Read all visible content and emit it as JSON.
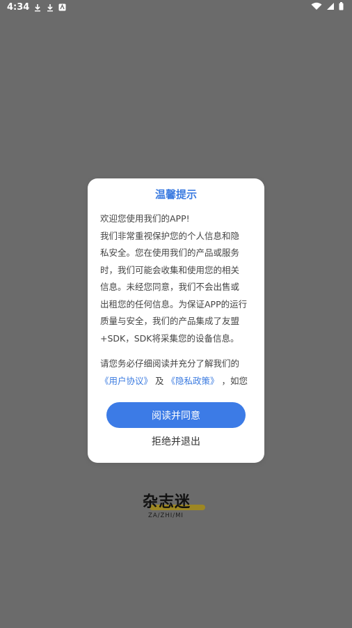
{
  "status_bar": {
    "time": "4:34",
    "left_icons": [
      "download-icon",
      "download-icon",
      "accessibility-icon"
    ],
    "right_icons": [
      "wifi-icon",
      "signal-icon",
      "battery-icon"
    ]
  },
  "app_logo": {
    "title": "杂志迷",
    "subtitle": "ZA/ZHI/MI"
  },
  "dialog": {
    "title": "温馨提示",
    "body_lines": [
      "欢迎您使用我们的APP!",
      "我们非常重视保护您的个人信息和隐",
      "私安全。您在使用我们的产品或服务",
      "时，我们可能会收集和使用您的相关",
      "信息。未经您同意，我们不会出售或",
      "出租您的任何信息。为保证APP的运行",
      "质量与安全，我们的产品集成了友盟",
      "+SDK，SDK将采集您的设备信息。"
    ],
    "read_notice": "请您务必仔细阅读并充分了解我们的",
    "link_user_agreement": "《用户协议》",
    "link_and": "及",
    "link_privacy_policy": "《隐私政策》",
    "link_suffix": "，如您",
    "agree_button": "阅读并同意",
    "reject_button": "拒绝并退出"
  },
  "colors": {
    "background": "#6b6b6b",
    "accent": "#3c7be6",
    "dialog_bg": "#ffffff"
  }
}
